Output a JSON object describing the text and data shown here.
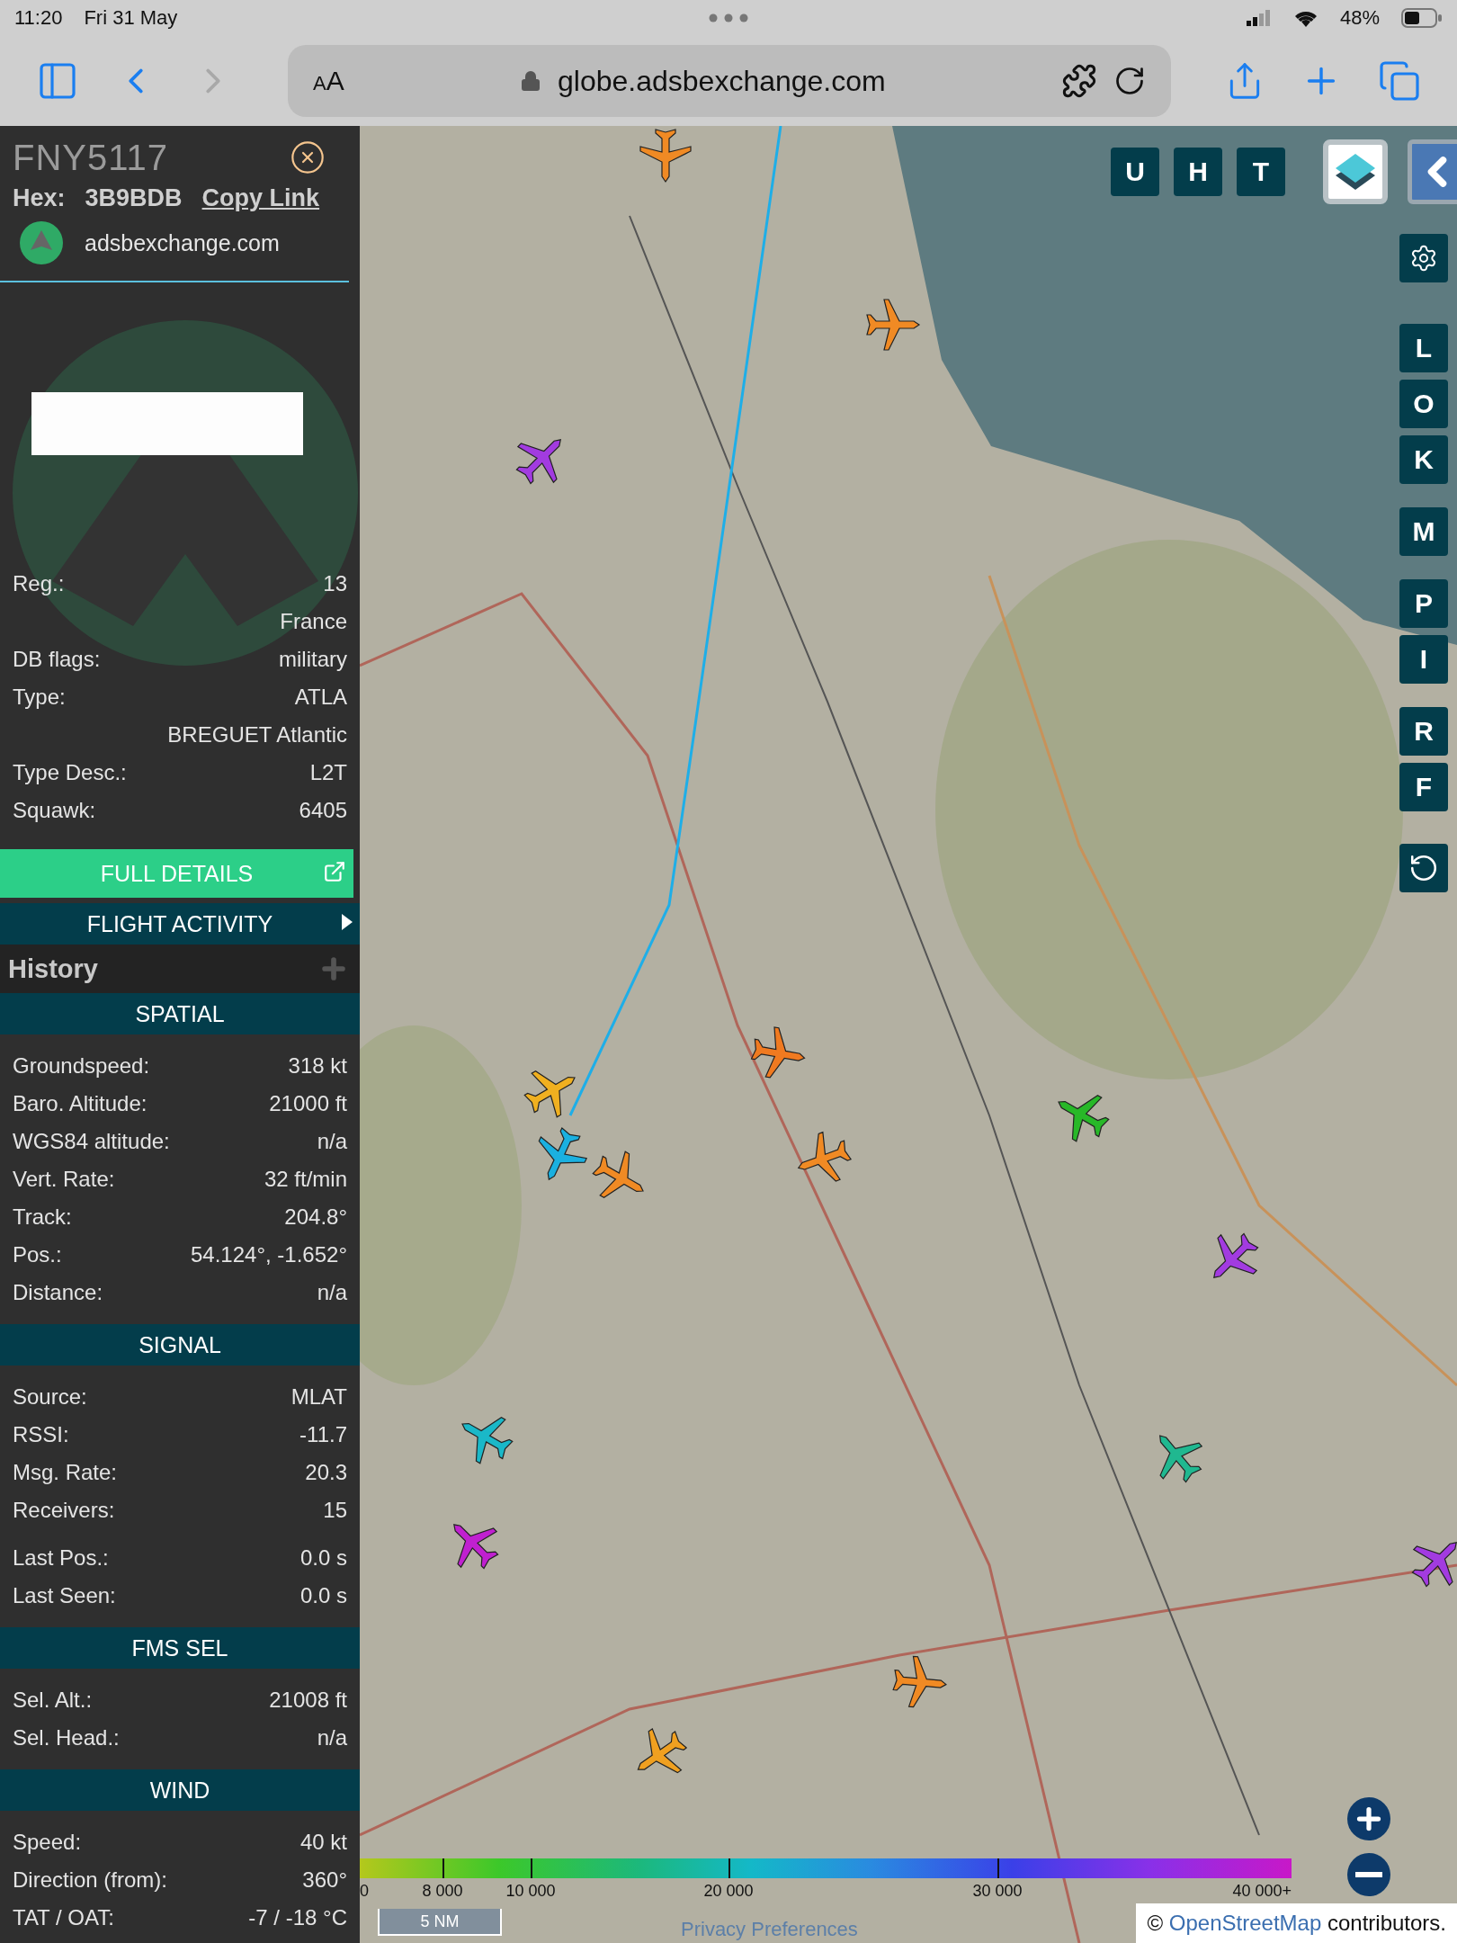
{
  "status_bar": {
    "time": "11:20",
    "date": "Fri 31 May",
    "battery": "48%"
  },
  "browser": {
    "text_size": "AA",
    "url": "globe.adsbexchange.com",
    "back_enabled": true,
    "forward_enabled": false
  },
  "aircraft_panel": {
    "callsign": "FNY5117",
    "hex_label": "Hex:",
    "hex": "3B9BDB",
    "copy_link": "Copy Link",
    "site": "adsbexchange.com",
    "details": [
      {
        "label": "Reg.:",
        "value": "13"
      },
      {
        "value": "France"
      },
      {
        "label": "DB flags:",
        "value": "military"
      },
      {
        "label": "Type:",
        "value": "ATLA"
      },
      {
        "value": "BREGUET Atlantic"
      },
      {
        "label": "Type Desc.:",
        "value": "L2T"
      },
      {
        "label": "Squawk:",
        "value": "6405"
      }
    ],
    "full_details": "FULL DETAILS",
    "flight_activity": "FLIGHT ACTIVITY",
    "history": "History",
    "sections": [
      {
        "title": "SPATIAL",
        "row_groups": [
          [
            {
              "label": "Groundspeed:",
              "value": "318 kt"
            },
            {
              "label": "Baro. Altitude:",
              "value": "21000 ft"
            },
            {
              "label": "WGS84 altitude:",
              "value": "n/a"
            },
            {
              "label": "Vert. Rate:",
              "value": "32 ft/min"
            },
            {
              "label": "Track:",
              "value": "204.8°"
            },
            {
              "label": "Pos.:",
              "value": "54.124°, -1.652°"
            },
            {
              "label": "Distance:",
              "value": "n/a"
            }
          ]
        ]
      },
      {
        "title": "SIGNAL",
        "row_groups": [
          [
            {
              "label": "Source:",
              "value": "MLAT"
            },
            {
              "label": "RSSI:",
              "value": "-11.7"
            },
            {
              "label": "Msg. Rate:",
              "value": "20.3"
            },
            {
              "label": "Receivers:",
              "value": "15"
            }
          ],
          [
            {
              "label": "Last Pos.:",
              "value": "0.0 s"
            },
            {
              "label": "Last Seen:",
              "value": "0.0 s"
            }
          ]
        ]
      },
      {
        "title": "FMS SEL",
        "row_groups": [
          [
            {
              "label": "Sel. Alt.:",
              "value": "21008 ft"
            },
            {
              "label": "Sel. Head.:",
              "value": "n/a"
            }
          ]
        ]
      },
      {
        "title": "WIND",
        "row_groups": [
          [
            {
              "label": "Speed:",
              "value": "40 kt"
            },
            {
              "label": "Direction (from):",
              "value": "360°"
            },
            {
              "label": "TAT / OAT:",
              "value": "-7 / -18 °C"
            }
          ]
        ]
      }
    ]
  },
  "map": {
    "view_buttons": [
      "U",
      "H",
      "T"
    ],
    "side_buttons": [
      "L",
      "O",
      "K",
      "M",
      "P",
      "I",
      "R",
      "F"
    ],
    "aircraft": [
      {
        "color": "#f08a24"
      },
      {
        "color": "#f08a24"
      },
      {
        "color": "#a23be0"
      },
      {
        "color": "#f07a20"
      },
      {
        "color": "#f0b020"
      },
      {
        "color": "#1ab0e0"
      },
      {
        "color": "#f08a24"
      },
      {
        "color": "#f08a24"
      },
      {
        "color": "#28b828"
      },
      {
        "color": "#a23be0"
      },
      {
        "color": "#1ab8c8"
      },
      {
        "color": "#20b890"
      },
      {
        "color": "#c020d0"
      },
      {
        "color": "#f08a24"
      },
      {
        "color": "#f0a020"
      },
      {
        "color": "#a23be0"
      }
    ],
    "altitude_legend": [
      "0",
      "8 000",
      "10 000",
      "20 000",
      "30 000",
      "40 000+"
    ],
    "scale": "5 NM",
    "privacy_link": "Privacy Preferences",
    "attribution": {
      "prefix": "©",
      "link": "OpenStreetMap",
      "suffix": "contributors."
    }
  }
}
